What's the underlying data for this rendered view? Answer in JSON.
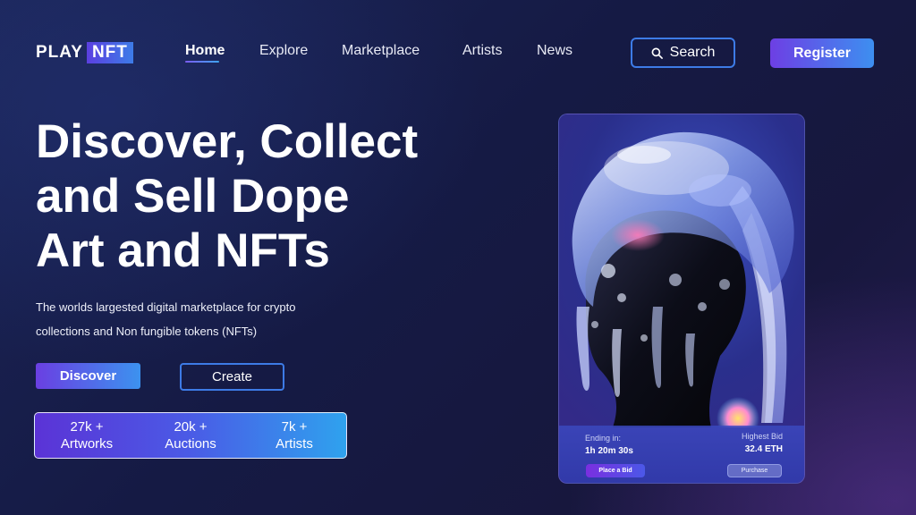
{
  "logo": {
    "play": "PLAY",
    "nft": "NFT"
  },
  "nav": {
    "items": [
      {
        "label": "Home",
        "active": true
      },
      {
        "label": "Explore"
      },
      {
        "label": "Marketplace"
      },
      {
        "label": "Artists"
      },
      {
        "label": "News"
      }
    ],
    "search_label": "Search",
    "search_icon": "search-icon",
    "register_label": "Register"
  },
  "hero": {
    "headline_lines": [
      "Discover, Collect",
      "and Sell Dope",
      "Art and NFTs"
    ],
    "subtitle_lines": [
      "The worlds largested digital marketplace for crypto",
      "collections and Non fungible tokens (NFTs)"
    ],
    "discover_label": "Discover",
    "create_label": "Create"
  },
  "stats": [
    {
      "value": "27k +",
      "label": "Artworks"
    },
    {
      "value": "20k +",
      "label": "Auctions"
    },
    {
      "value": "7k +",
      "label": "Artists"
    }
  ],
  "card": {
    "ending_label": "Ending in:",
    "ending_value": "1h 20m 30s",
    "bid_label": "Highest Bid",
    "bid_value": "32.4 ETH",
    "place_bid_label": "Place a Bid",
    "purchase_label": "Purchase"
  },
  "colors": {
    "accent_purple": "#6a3fe2",
    "accent_blue": "#3c92ef",
    "background": "#161b45"
  }
}
